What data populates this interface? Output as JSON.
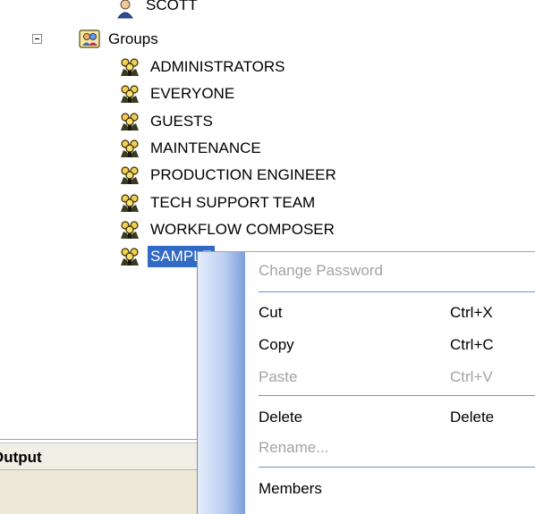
{
  "tree": {
    "partial_user": "SCOTT",
    "groups_label": "Groups",
    "groups": [
      "ADMINISTRATORS",
      "EVERYONE",
      "GUESTS",
      "MAINTENANCE",
      "PRODUCTION ENGINEER",
      "TECH SUPPORT TEAM",
      "WORKFLOW COMPOSER",
      "SAMPLE"
    ]
  },
  "output_panel": {
    "title": "Output"
  },
  "context_menu": {
    "items": [
      {
        "label": "Change Password",
        "shortcut": "",
        "enabled": false
      },
      {
        "label": "Cut",
        "shortcut": "Ctrl+X",
        "enabled": true
      },
      {
        "label": "Copy",
        "shortcut": "Ctrl+C",
        "enabled": true
      },
      {
        "label": "Paste",
        "shortcut": "Ctrl+V",
        "enabled": false
      },
      {
        "label": "Delete",
        "shortcut": "Delete",
        "enabled": true
      },
      {
        "label": "Rename...",
        "shortcut": "",
        "enabled": false
      },
      {
        "label": "Members",
        "shortcut": "",
        "enabled": true
      }
    ]
  },
  "colors": {
    "selection": "#316ac5",
    "menu_separator": "#6b8fd6",
    "disabled_text": "#a3a3a3"
  },
  "icons": {
    "user": "user-icon",
    "groups_folder": "groups-folder-icon",
    "group": "group-icon"
  }
}
